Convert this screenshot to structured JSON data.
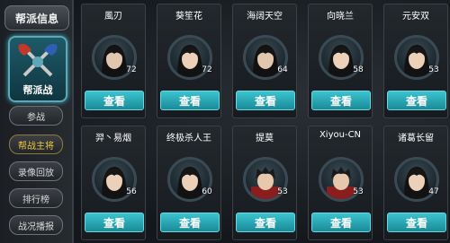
{
  "sidebar": {
    "top_button": "帮派信息",
    "emblem_label": "帮派战",
    "buttons": [
      "参战",
      "帮战主将",
      "录像回放",
      "排行榜",
      "战况播报"
    ],
    "active_index": 1
  },
  "view_label": "查看",
  "players": [
    {
      "name": "風刃",
      "level": "72"
    },
    {
      "name": "葵笙花",
      "level": "72"
    },
    {
      "name": "海阔天空",
      "level": "64"
    },
    {
      "name": "向晓兰",
      "level": "58"
    },
    {
      "name": "元安双",
      "level": "53"
    },
    {
      "name": "羿丶易烟",
      "level": "56"
    },
    {
      "name": "终极杀人王",
      "level": "60"
    },
    {
      "name": "提莫",
      "level": "53"
    },
    {
      "name": "Xiyou-CN",
      "level": "53"
    },
    {
      "name": "诸葛长留",
      "level": "47"
    }
  ],
  "colors": {
    "accent": "#3cc3cf",
    "active_text": "#f1c542"
  }
}
